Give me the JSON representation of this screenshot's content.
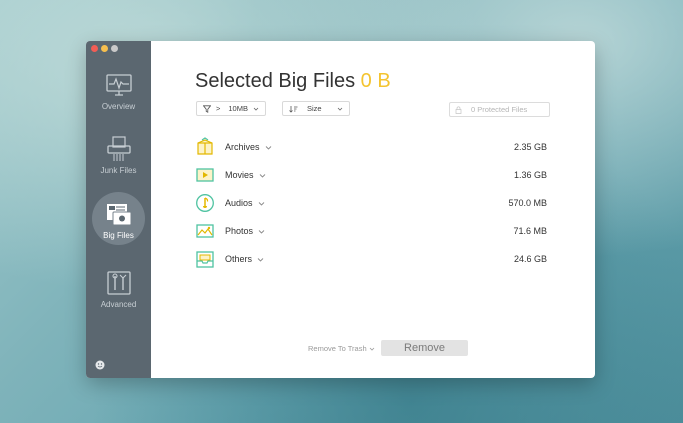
{
  "sidebar": {
    "items": [
      {
        "label": "Overview",
        "icon": "monitor-pulse-icon"
      },
      {
        "label": "Junk Files",
        "icon": "shredder-icon"
      },
      {
        "label": "Big Files",
        "icon": "big-files-icon"
      },
      {
        "label": "Advanced",
        "icon": "tools-icon"
      }
    ],
    "active_index": 2
  },
  "main": {
    "title": "Selected Big Files",
    "selected_size": "0 B",
    "filters": {
      "size_prefix": ">",
      "size_value": "10MB",
      "sort_value": "Size"
    },
    "protected_files": "0 Protected Files",
    "categories": [
      {
        "label": "Archives",
        "size": "2.35 GB",
        "icon": "archive-box-icon"
      },
      {
        "label": "Movies",
        "size": "1.36 GB",
        "icon": "movie-icon"
      },
      {
        "label": "Audios",
        "size": "570.0 MB",
        "icon": "audio-icon"
      },
      {
        "label": "Photos",
        "size": "71.6 MB",
        "icon": "photo-icon"
      },
      {
        "label": "Others",
        "size": "24.6 GB",
        "icon": "inbox-tray-icon"
      }
    ],
    "remove_to_trash": "Remove To Trash",
    "remove_button": "Remove"
  },
  "colors": {
    "accent_yellow": "#f4c430",
    "icon_green": "#4fc3a1",
    "sidebar_bg": "#5b6770"
  }
}
